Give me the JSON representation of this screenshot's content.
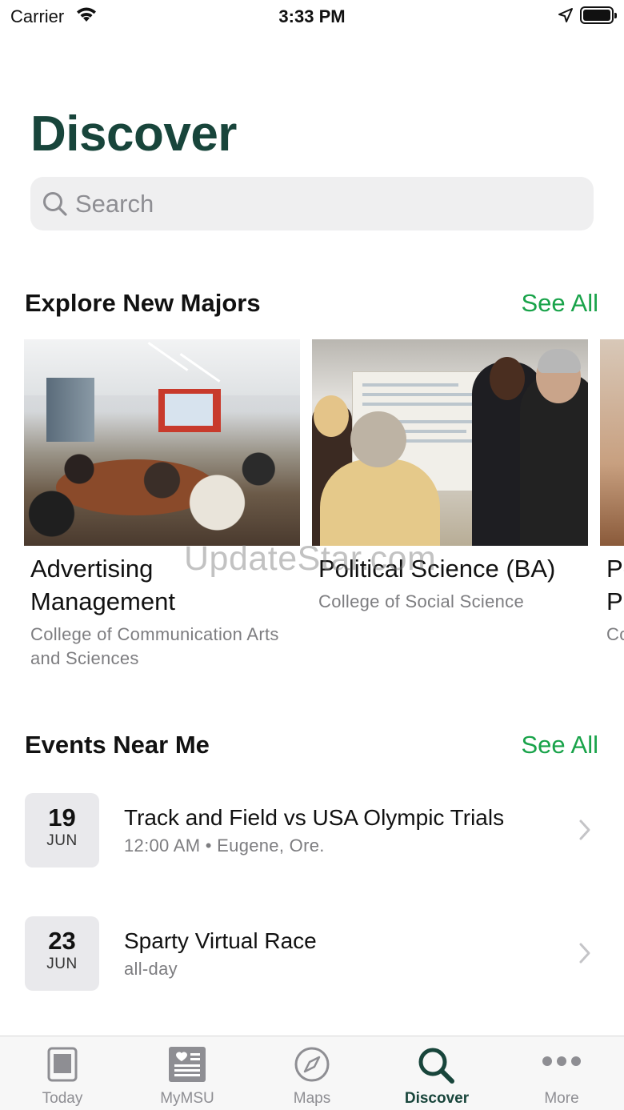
{
  "status_bar": {
    "carrier": "Carrier",
    "time": "3:33 PM"
  },
  "page": {
    "title": "Discover"
  },
  "search": {
    "placeholder": "Search"
  },
  "majors_section": {
    "title": "Explore New Majors",
    "see_all": "See All",
    "items": [
      {
        "name": "Advertising Management",
        "college": "College of Communication Arts and Sciences"
      },
      {
        "name": "Political Science (BA)",
        "college": "College of Social Science"
      },
      {
        "name": "Po\nPr",
        "college": "Co"
      }
    ]
  },
  "watermark": "UpdateStar.com",
  "events_section": {
    "title": "Events Near Me",
    "see_all": "See All",
    "items": [
      {
        "day": "19",
        "month": "JUN",
        "title": "Track and Field vs USA Olympic Trials",
        "subtitle": "12:00 AM • Eugene, Ore."
      },
      {
        "day": "23",
        "month": "JUN",
        "title": "Sparty Virtual Race",
        "subtitle": "all-day"
      }
    ]
  },
  "tab_bar": {
    "active": "Discover",
    "tabs": [
      {
        "label": "Today",
        "icon": "today-icon"
      },
      {
        "label": "MyMSU",
        "icon": "mymsu-icon"
      },
      {
        "label": "Maps",
        "icon": "compass-icon"
      },
      {
        "label": "Discover",
        "icon": "search-icon"
      },
      {
        "label": "More",
        "icon": "more-icon"
      }
    ]
  },
  "colors": {
    "brand_green": "#18453b",
    "link_green": "#19a34a",
    "inactive_gray": "#8e8e93"
  }
}
